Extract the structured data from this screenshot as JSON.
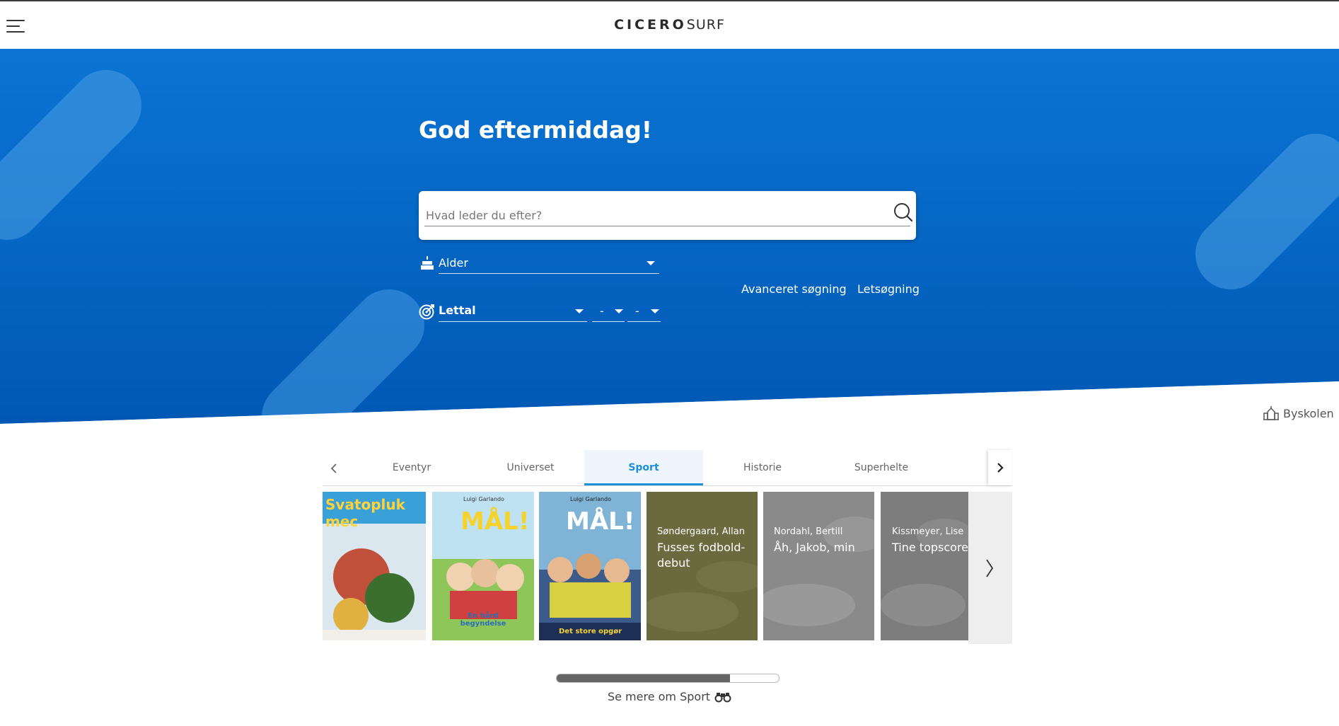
{
  "header": {
    "logo_main": "CICERO",
    "logo_sub": "SURF",
    "menu_icon": "hamburger-menu-icon"
  },
  "hero": {
    "greeting": "God eftermiddag!",
    "search": {
      "placeholder": "Hvad leder du efter?",
      "value": "",
      "icon": "search-icon"
    },
    "age_filter": {
      "label": "Alder",
      "icon": "cake-icon"
    },
    "level_filter": {
      "label": "Lettal",
      "icon": "target-icon"
    },
    "range_from": "-",
    "range_to": "-",
    "links": {
      "advanced": "Avanceret søgning",
      "easy": "Letsøgning"
    },
    "colors": {
      "hero_blue": "#0a6fd0",
      "hero_dark": "#005ab7"
    }
  },
  "location": {
    "label": "Byskolen",
    "icon": "school-icon"
  },
  "tabs": {
    "items": [
      {
        "label": "Eventyr"
      },
      {
        "label": "Universet"
      },
      {
        "label": "Sport",
        "active": true
      },
      {
        "label": "Historie"
      },
      {
        "label": "Superhelte"
      }
    ],
    "accent": "#1d8fd8"
  },
  "books": [
    {
      "cover_text": "Svatopluk mec",
      "kind": "illustrated"
    },
    {
      "cover_author": "Luigi Garlando",
      "cover_title": "MÅL!",
      "cover_subtitle": "En hård begyndelse",
      "kind": "illustrated"
    },
    {
      "cover_author": "Luigi Garlando",
      "cover_title": "MÅL!",
      "cover_subtitle": "Det store opgør",
      "kind": "illustrated"
    },
    {
      "author": "Søndergaard, Allan",
      "title": "Fusses fodbold-debut",
      "kind": "placeholder",
      "color": "#6b6a3f"
    },
    {
      "author": "Nordahl, Bertill",
      "title": "Åh, Jakob, min",
      "kind": "placeholder",
      "color": "#8a8a8a"
    },
    {
      "author": "Kissmeyer, Lise",
      "title": "Tine topscorer",
      "kind": "placeholder",
      "color": "#7d7d7d"
    }
  ],
  "carousel": {
    "progress_fraction": 0.78
  },
  "more_link": {
    "label": "Se mere om Sport",
    "icon": "binoculars-icon"
  }
}
